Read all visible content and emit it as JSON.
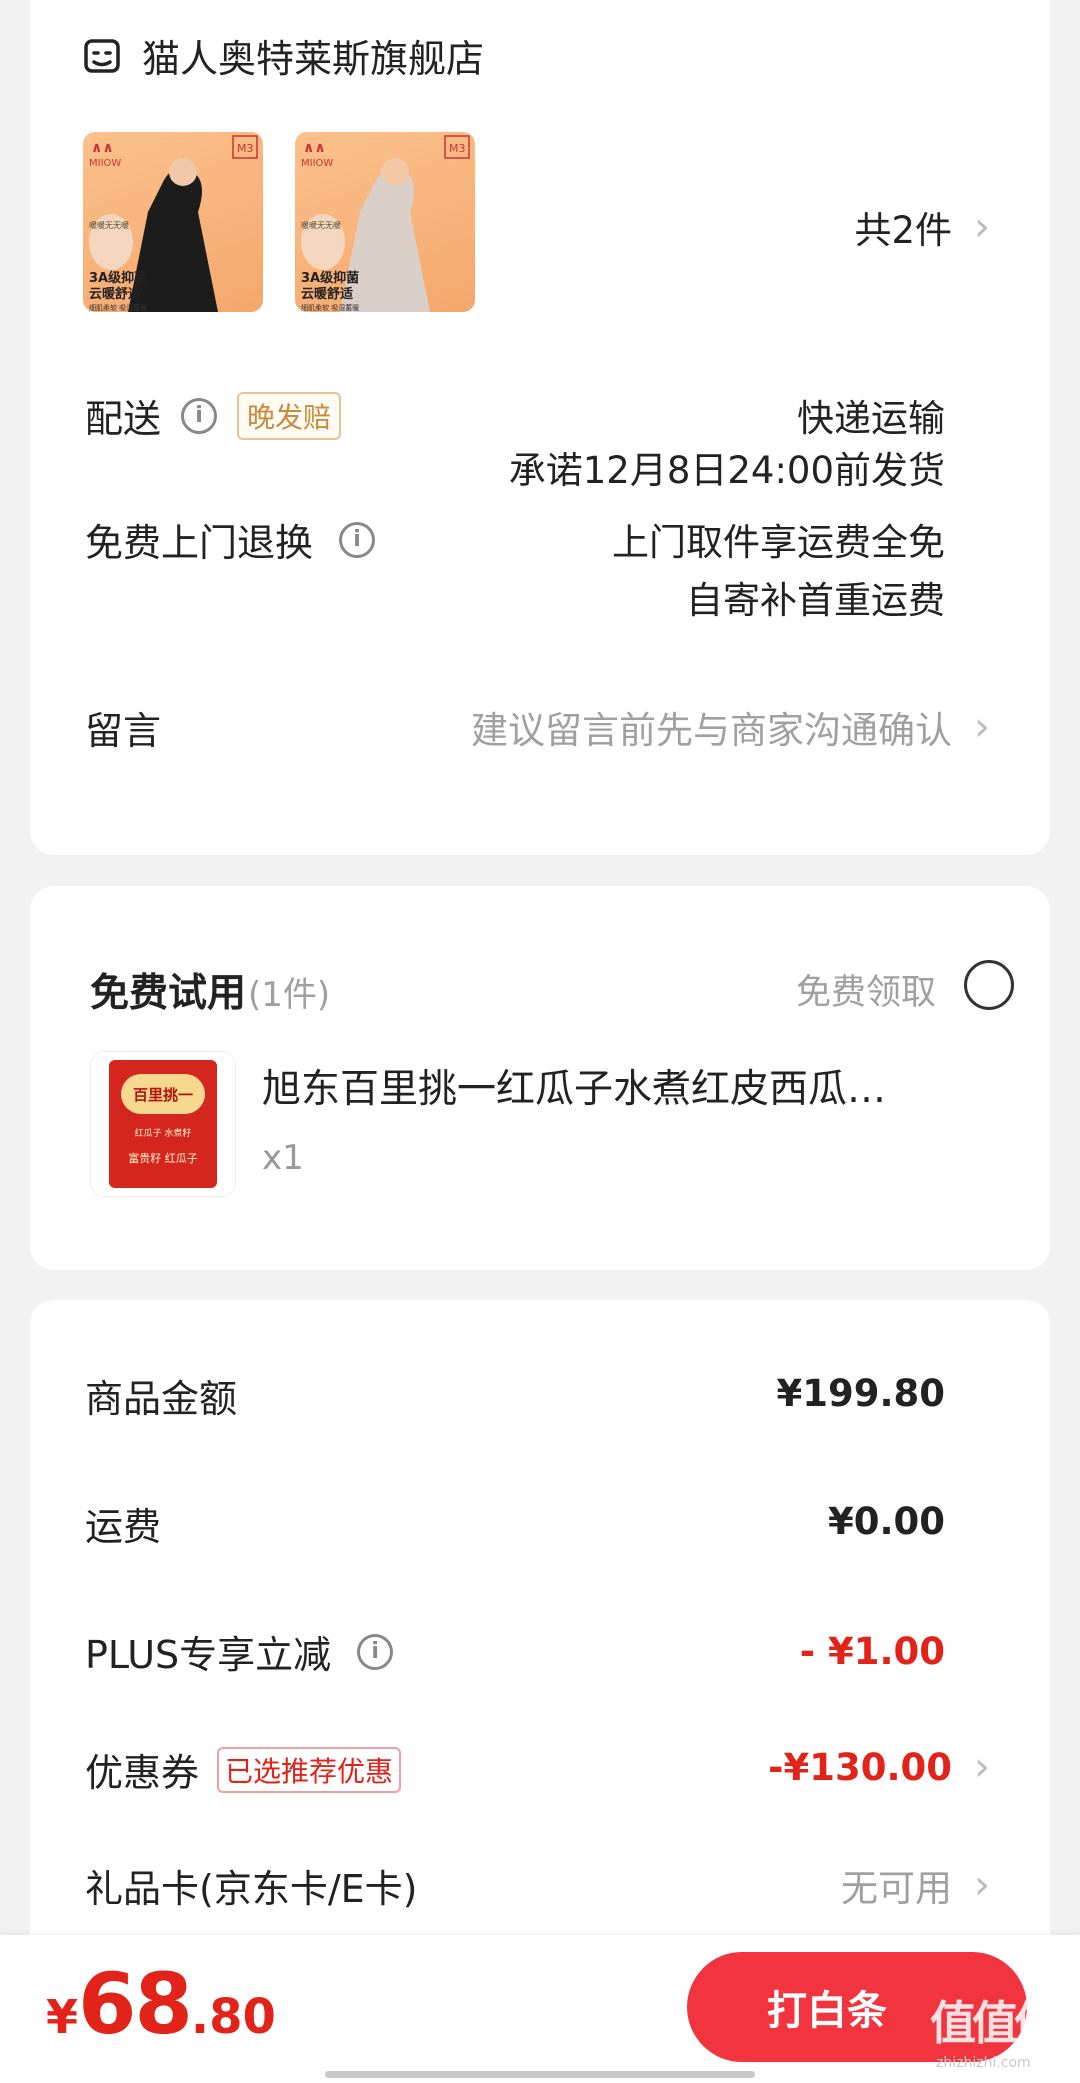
{
  "store": {
    "name": "猫人奥特莱斯旗舰店",
    "icon": "store-icon"
  },
  "products": {
    "items": [
      {
        "brand": "MIIOW",
        "size": "M3",
        "line1": "3A级抑菌",
        "line2": "云暖舒适",
        "sub": "细肌柔软 吸湿蓄暖",
        "top": "暖暖无无暖",
        "garment_color": "#1c1c1c"
      },
      {
        "brand": "MIIOW",
        "size": "M3",
        "line1": "3A级抑菌",
        "line2": "云暖舒适",
        "sub": "细肌柔软 吸湿蓄暖",
        "top": "暖暖无无暖",
        "garment_color": "#d9cfc8"
      }
    ],
    "count_label": "共2件"
  },
  "delivery": {
    "label": "配送",
    "tag": "晚发赔",
    "method": "快递运输",
    "promise": "承诺12月8日24:00前发货"
  },
  "returns": {
    "label": "免费上门退换",
    "line1": "上门取件享运费全免",
    "line2": "自寄补首重运费"
  },
  "message": {
    "label": "留言",
    "placeholder": "建议留言前先与商家沟通确认"
  },
  "trial": {
    "title": "免费试用",
    "count": "(1件)",
    "action": "免费领取",
    "product_name": "旭东百里挑一红瓜子水煮红皮西瓜…",
    "qty": "x1",
    "pack_text_top": "百里挑一",
    "pack_text_mid": "红瓜子 水煮籽",
    "pack_text_bottom": "富贵籽 红瓜子"
  },
  "summary": {
    "goods_label": "商品金额",
    "goods_value": "¥199.80",
    "shipping_label": "运费",
    "shipping_value": "¥0.00",
    "plus_label": "PLUS专享立减",
    "plus_value": "- ¥1.00",
    "coupon_label": "优惠券",
    "coupon_tag": "已选推荐优惠",
    "coupon_value": "-¥130.00",
    "giftcard_label": "礼品卡(京东卡/E卡)",
    "giftcard_value": "无可用"
  },
  "footer": {
    "currency": "¥",
    "price_int": "68",
    "price_dec": ".80",
    "pay_button": "打白条"
  },
  "watermark": {
    "text": "值值值",
    "url": "zhizhizhi.com"
  },
  "colors": {
    "accent": "#e2231a",
    "button": "#f2343f",
    "tag_gold": "#c88b3d"
  }
}
